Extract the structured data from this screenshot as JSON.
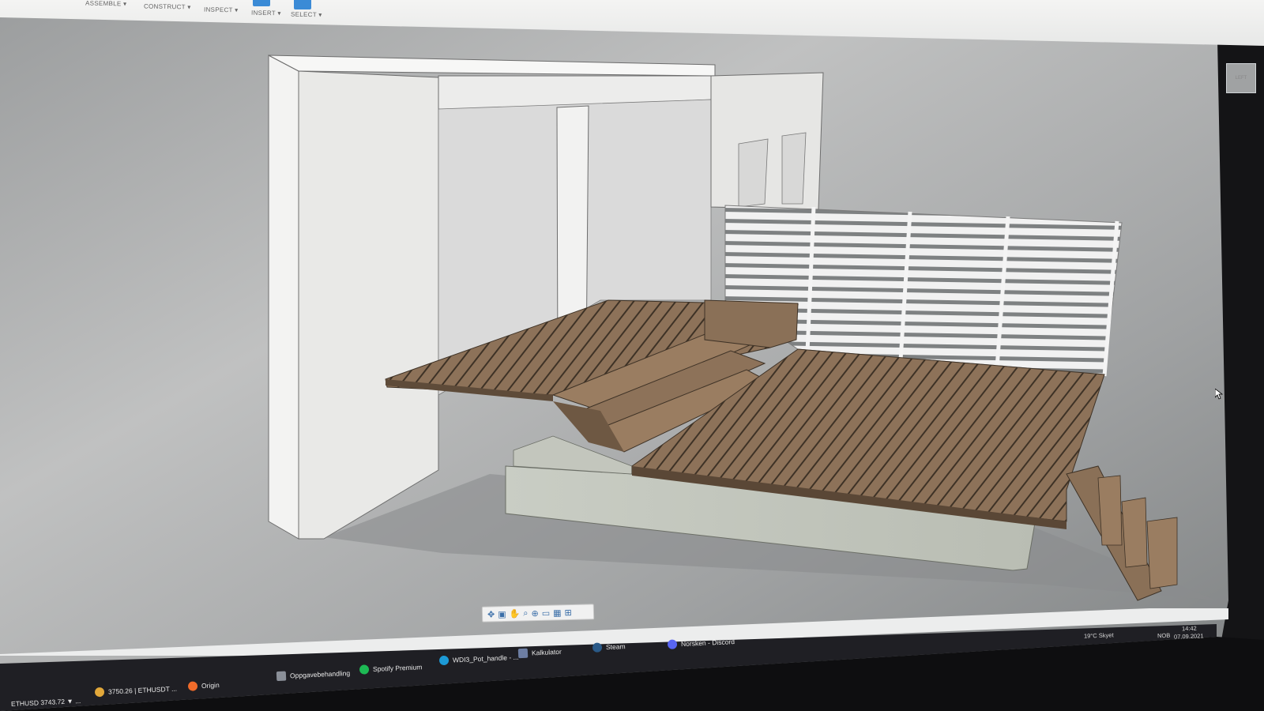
{
  "toolbar": {
    "items": [
      {
        "label": "ASSEMBLE ▾"
      },
      {
        "label": "CONSTRUCT ▾"
      },
      {
        "label": "INSPECT ▾"
      },
      {
        "label": "INSERT ▾"
      },
      {
        "label": "SELECT ▾"
      }
    ]
  },
  "viewcube": {
    "label": "LEFT"
  },
  "taskbar": {
    "apps": [
      {
        "label": "ETHUSD 3743.72 ▼ ..."
      },
      {
        "label": "3750.26 | ETHUSDT ..."
      },
      {
        "label": "Origin"
      },
      {
        "label": "Oppgavebehandling"
      },
      {
        "label": "Spotify Premium"
      },
      {
        "label": "WDI3_Pot_handle - ..."
      },
      {
        "label": "Kalkulator"
      },
      {
        "label": "Steam"
      },
      {
        "label": "Norsken - Discord"
      }
    ],
    "tray": {
      "weather": "19°C  Skyet",
      "language": "NOB",
      "time": "14:42",
      "date": "07.09.2021"
    }
  },
  "colors": {
    "viewport_bg": "#9a9c9d",
    "deck_wood": "#8a7057",
    "wall": "#e8e8e6",
    "accent": "#3b8bd6",
    "taskbar": "#1f1f24"
  }
}
